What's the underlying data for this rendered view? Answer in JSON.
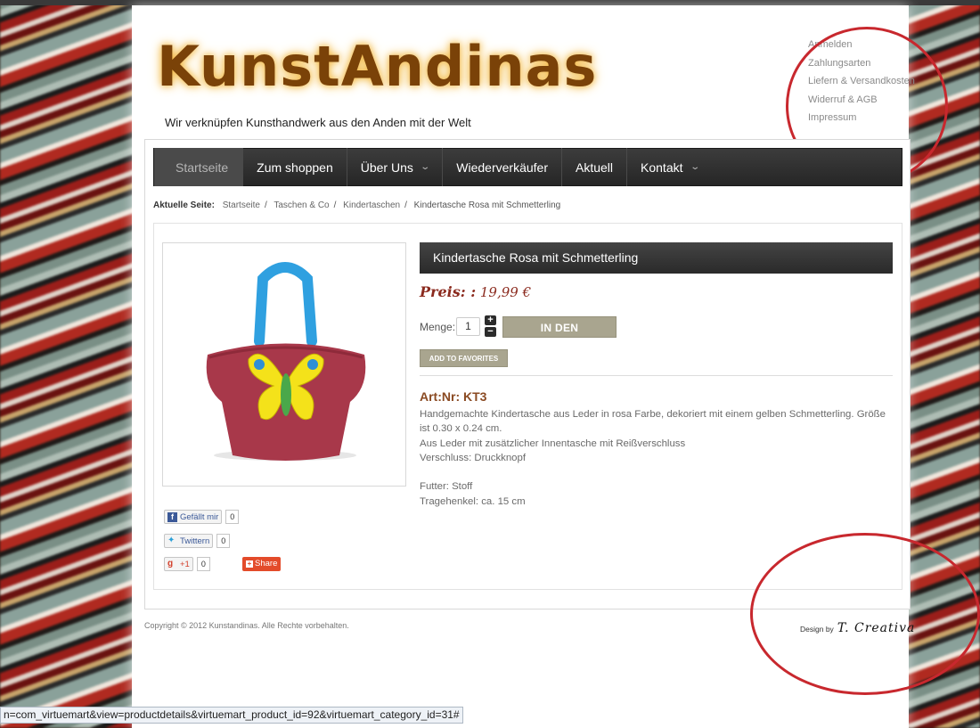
{
  "header": {
    "logo_text": "KunstAndinas",
    "tagline": "Wir verknüpfen Kunsthandwerk aus den Anden mit der Welt",
    "top_links": [
      "Anmelden",
      "Zahlungsarten",
      "Liefern & Versandkosten",
      "Widerruf & AGB",
      "Impressum"
    ]
  },
  "nav": {
    "items": [
      {
        "label": "Startseite",
        "active": true,
        "has_caret": false
      },
      {
        "label": "Zum shoppen",
        "active": false,
        "has_caret": false
      },
      {
        "label": "Über Uns",
        "active": false,
        "has_caret": true
      },
      {
        "label": "Wiederverkäufer",
        "active": false,
        "has_caret": false
      },
      {
        "label": "Aktuell",
        "active": false,
        "has_caret": false
      },
      {
        "label": "Kontakt",
        "active": false,
        "has_caret": true
      }
    ]
  },
  "breadcrumb": {
    "prefix": "Aktuelle Seite:",
    "items": [
      "Startseite",
      "Taschen & Co",
      "Kindertaschen",
      "Kindertasche Rosa mit Schmetterling"
    ]
  },
  "product": {
    "title": "Kindertasche Rosa mit Schmetterling",
    "price_label": "Preis: :",
    "price": "19,99 €",
    "qty_label": "Menge:",
    "qty_value": "1",
    "stepper_plus": "+",
    "stepper_minus": "−",
    "cart_button": "IN DEN WARENKORB",
    "fav_button": "ADD TO FAVORITES",
    "artnr": "Art:Nr: KT3",
    "description": [
      "Handgemachte Kindertasche aus Leder in rosa Farbe, dekoriert mit einem gelben Schmetterling. Größe ist 0.30 x 0.24 cm.",
      "Aus Leder mit zusätzlicher Innentasche mit Reißverschluss",
      "Verschluss: Druckknopf"
    ],
    "details": [
      "Futter: Stoff",
      "Tragehenkel: ca. 15 cm"
    ],
    "colors": {
      "bag": "#a8384a",
      "handle": "#2fa0e0",
      "butterfly": "#f4e21a",
      "butterfly_spot": "#2f8fd6",
      "butterfly_body": "#4aa84a"
    }
  },
  "social": {
    "facebook_label": "Gefällt mir",
    "facebook_count": "0",
    "twitter_label": "Twittern",
    "twitter_count": "0",
    "gplus_label": "+1",
    "gplus_count": "0",
    "share_label": "Share"
  },
  "footer": {
    "copyright": "Copyright © 2012 Kunstandinas. Alle Rechte vorbehalten.",
    "design_by": "Design by",
    "design_brand": "T. Creativa"
  },
  "statusbar": {
    "url": "n=com_virtuemart&view=productdetails&virtuemart_product_id=92&virtuemart_category_id=31#"
  },
  "colors": {
    "accent": "#8b2a1e",
    "annotation": "#c8282e",
    "nav_bg": "#2e2e2e",
    "button": "#a9a58f"
  }
}
